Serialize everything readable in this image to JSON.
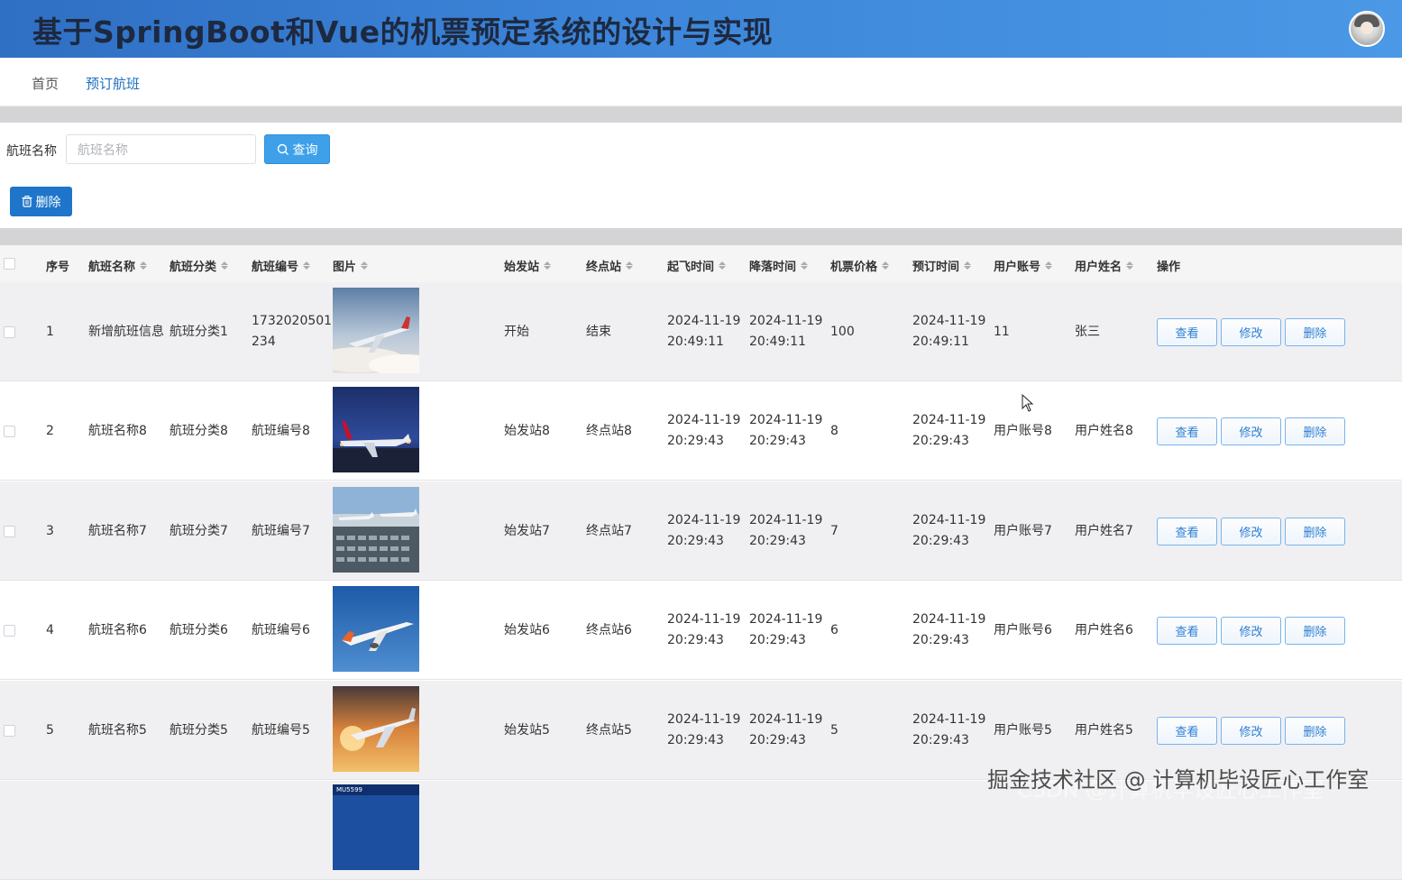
{
  "header": {
    "title": "基于SpringBoot和Vue的机票预定系统的设计与实现",
    "avatar_icon": "user-avatar"
  },
  "nav": {
    "items": [
      {
        "label": "首页",
        "active": false
      },
      {
        "label": "预订航班",
        "active": true
      }
    ]
  },
  "search": {
    "label": "航班名称",
    "placeholder": "航班名称",
    "value": "",
    "button_label": "查询",
    "button_icon": "search-icon"
  },
  "toolbar": {
    "delete_label": "删除",
    "delete_icon": "trash-icon"
  },
  "table": {
    "columns": [
      "序号",
      "航班名称",
      "航班分类",
      "航班编号",
      "图片",
      "始发站",
      "终点站",
      "起飞时间",
      "降落时间",
      "机票价格",
      "预订时间",
      "用户账号",
      "用户姓名",
      "操作"
    ],
    "action_labels": {
      "view": "查看",
      "edit": "修改",
      "delete": "删除"
    },
    "rows": [
      {
        "index": "1",
        "name": "新增航班信息",
        "category": "航班分类1",
        "code_line1": "1732020501",
        "code_line2": "234",
        "origin": "开始",
        "destination": "结束",
        "depart_date": "2024-11-19",
        "depart_time": "20:49:11",
        "land_date": "2024-11-19",
        "land_time": "20:49:11",
        "price": "100",
        "book_date": "2024-11-19",
        "book_time": "20:49:11",
        "account": "11",
        "user_name": "张三",
        "image_scene": "plane-over-clouds"
      },
      {
        "index": "2",
        "name": "航班名称8",
        "category": "航班分类8",
        "code_line1": "航班编号8",
        "code_line2": "",
        "origin": "始发站8",
        "destination": "终点站8",
        "depart_date": "2024-11-19",
        "depart_time": "20:29:43",
        "land_date": "2024-11-19",
        "land_time": "20:29:43",
        "price": "8",
        "book_date": "2024-11-19",
        "book_time": "20:29:43",
        "account": "用户账号8",
        "user_name": "用户姓名8",
        "image_scene": "plane-at-night"
      },
      {
        "index": "3",
        "name": "航班名称7",
        "category": "航班分类7",
        "code_line1": "航班编号7",
        "code_line2": "",
        "origin": "始发站7",
        "destination": "终点站7",
        "depart_date": "2024-11-19",
        "depart_time": "20:29:43",
        "land_date": "2024-11-19",
        "land_time": "20:29:43",
        "price": "7",
        "book_date": "2024-11-19",
        "book_time": "20:29:43",
        "account": "用户账号7",
        "user_name": "用户姓名7",
        "image_scene": "airport-parking"
      },
      {
        "index": "4",
        "name": "航班名称6",
        "category": "航班分类6",
        "code_line1": "航班编号6",
        "code_line2": "",
        "origin": "始发站6",
        "destination": "终点站6",
        "depart_date": "2024-11-19",
        "depart_time": "20:29:43",
        "land_date": "2024-11-19",
        "land_time": "20:29:43",
        "price": "6",
        "book_date": "2024-11-19",
        "book_time": "20:29:43",
        "account": "用户账号6",
        "user_name": "用户姓名6",
        "image_scene": "plane-blue-sky"
      },
      {
        "index": "5",
        "name": "航班名称5",
        "category": "航班分类5",
        "code_line1": "航班编号5",
        "code_line2": "",
        "origin": "始发站5",
        "destination": "终点站5",
        "depart_date": "2024-11-19",
        "depart_time": "20:29:43",
        "land_date": "2024-11-19",
        "land_time": "20:29:43",
        "price": "5",
        "book_date": "2024-11-19",
        "book_time": "20:29:43",
        "account": "用户账号5",
        "user_name": "用户姓名5",
        "image_scene": "plane-sunset"
      }
    ],
    "partial_row_image_text": "MU5599"
  },
  "watermark": {
    "line1": "掘金技术社区 @ 计算机毕设匠心工作室",
    "line2": "CSDN @计算机毕设匠心工作室"
  },
  "colors": {
    "header_start": "#2f6fc4",
    "header_end": "#4a98e6",
    "primary": "#1f75c9",
    "query_button": "#3ea0e9",
    "link": "#2d7fd3"
  }
}
